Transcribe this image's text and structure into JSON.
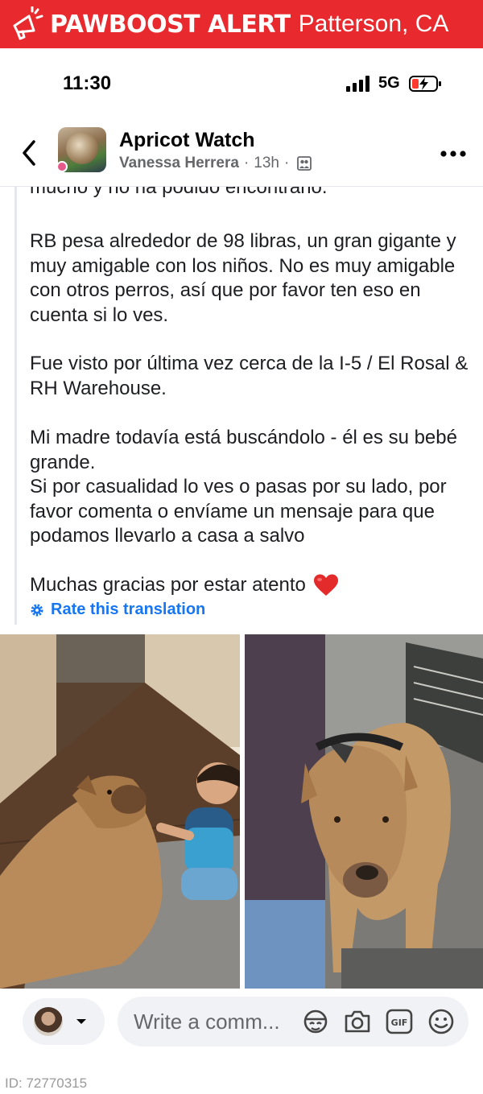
{
  "banner": {
    "brand": "PAWBOOST ALERT",
    "location": "Patterson, CA",
    "color": "#e8292d"
  },
  "status_bar": {
    "time": "11:30",
    "network": "5G"
  },
  "post": {
    "group_name": "Apricot Watch",
    "author": "Vanessa Herrera",
    "age": "13h",
    "separator": "·",
    "truncated_line": "mucho y no ha podido encontrarlo.",
    "paragraphs": [
      "RB pesa alrededor de 98 libras, un gran gigante y muy amigable con los niños. No es muy amigable con otros perros, así que por favor ten eso en cuenta si lo ves.",
      "Fue visto por última vez cerca de la I-5 / El Rosal & RH Warehouse.",
      "Mi madre todavía está buscándolo - él es su bebé grande.\nSi por casualidad lo ves o pasas por su lado, por favor comenta o envíame un mensaje para que podamos llevarlo a casa a salvo",
      "Muchas gracias por estar atento"
    ],
    "rate_translation": "Rate this translation",
    "link_color": "#1876f2"
  },
  "icons": {
    "banner": "megaphone-icon",
    "back": "chevron-left-icon",
    "more": "more-horizontal-icon",
    "privacy": "group-privacy-icon",
    "heart": "red-heart-emoji",
    "rate": "gear-icon",
    "comment_icons": [
      "avatar-sticker-icon",
      "camera-icon",
      "gif-icon",
      "emoji-smile-icon"
    ]
  },
  "comment_bar": {
    "placeholder": "Write a comm..."
  },
  "footer": {
    "id_label": "ID: 72770315"
  }
}
